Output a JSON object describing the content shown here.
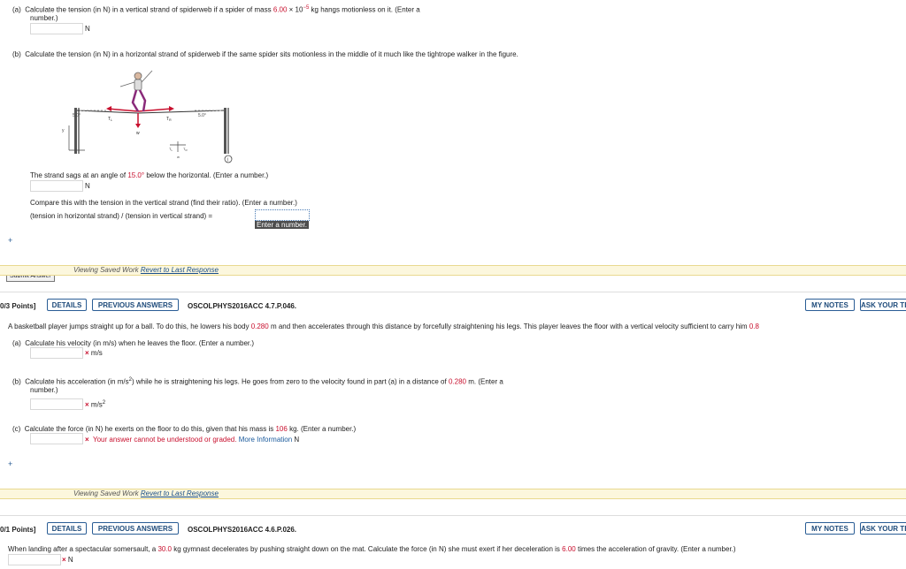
{
  "q1": {
    "a_prefix": "(a)",
    "a_text_1": "Calculate the tension (in N) in a vertical strand of spiderweb if a spider of mass",
    "a_mass": "6.00",
    "a_times": "×",
    "a_ten": "10",
    "a_exp": "−5",
    "a_text_2": "kg hangs motionless on it. (Enter a",
    "a_text_3": "number.)",
    "a_unit": "N",
    "b_prefix": "(b)",
    "b_text": "Calculate the tension (in N) in a horizontal strand of spiderweb if the same spider sits motionless in the middle of it much like the tightrope walker in the figure.",
    "figure": {
      "angle_left": "5.0°",
      "angle_right": "5.0°",
      "t_l": "T",
      "t_l_sub": "L",
      "t_r": "T",
      "t_r_sub": "R",
      "w": "w",
      "y_axis": "y",
      "info_icon": "i"
    },
    "sag_text_1": "The strand sags at an angle of",
    "sag_angle": "15.0°",
    "sag_text_2": "below the horizontal. (Enter a number.)",
    "sag_unit": "N",
    "compare_text": "Compare this with the tension in the vertical strand (find their ratio). (Enter a number.)",
    "ratio_label": "(tension in horizontal strand) / (tension in vertical strand) =",
    "tooltip": "Enter a number.",
    "plus": "+",
    "submit": "Submit Answer",
    "saved_label": "Viewing Saved Work",
    "revert_link": "Revert to Last Response"
  },
  "q2": {
    "points": "0/3 Points]",
    "details": "DETAILS",
    "previous_answers": "PREVIOUS ANSWERS",
    "problem_id": "OSCOLPHYS2016ACC 4.7.P.046.",
    "my_notes": "MY NOTES",
    "ask_teacher": "ASK YOUR TEACHER",
    "stem_1": "A basketball player jumps straight up for a ball. To do this, he lowers his body",
    "stem_dist": "0.280",
    "stem_2": "m and then accelerates through this distance by forcefully straightening his legs. This player leaves the floor with a vertical velocity sufficient to carry him",
    "stem_tail": "0.8",
    "a_prefix": "(a)",
    "a_text": "Calculate his velocity (in m/s) when he leaves the floor. (Enter a number.)",
    "a_unit": "m/s",
    "b_prefix": "(b)",
    "b_text_1": "Calculate his acceleration (in m/s",
    "b_sup": "2",
    "b_text_2": ") while he is straightening his legs. He goes from zero to the velocity found in part (a) in a distance of",
    "b_dist": "0.280",
    "b_text_3": "m. (Enter a",
    "b_text_4": "number.)",
    "b_unit": "m/s",
    "b_unit_sup": "2",
    "c_prefix": "(c)",
    "c_text_1": "Calculate the force (in N) he exerts on the floor to do this, given that his mass is",
    "c_mass": "106",
    "c_text_2": "kg. (Enter a number.)",
    "c_error": "Your answer cannot be understood or graded.",
    "c_more": "More Information",
    "c_unit": "N",
    "plus": "+",
    "saved_label": "Viewing Saved Work",
    "revert_link": "Revert to Last Response",
    "x": "×"
  },
  "q3": {
    "points": "0/1 Points]",
    "details": "DETAILS",
    "previous_answers": "PREVIOUS ANSWERS",
    "problem_id": "OSCOLPHYS2016ACC 4.6.P.026.",
    "my_notes": "MY NOTES",
    "ask_teacher": "ASK YOUR TEACHER",
    "stem_1": "When landing after a spectacular somersault, a",
    "stem_mass": "30.0",
    "stem_2": "kg gymnast decelerates by pushing straight down on the mat. Calculate the force (in N) she must exert if her deceleration is",
    "stem_factor": "6.00",
    "stem_3": "times the acceleration of gravity. (Enter a number.)",
    "unit": "N",
    "x": "×"
  }
}
